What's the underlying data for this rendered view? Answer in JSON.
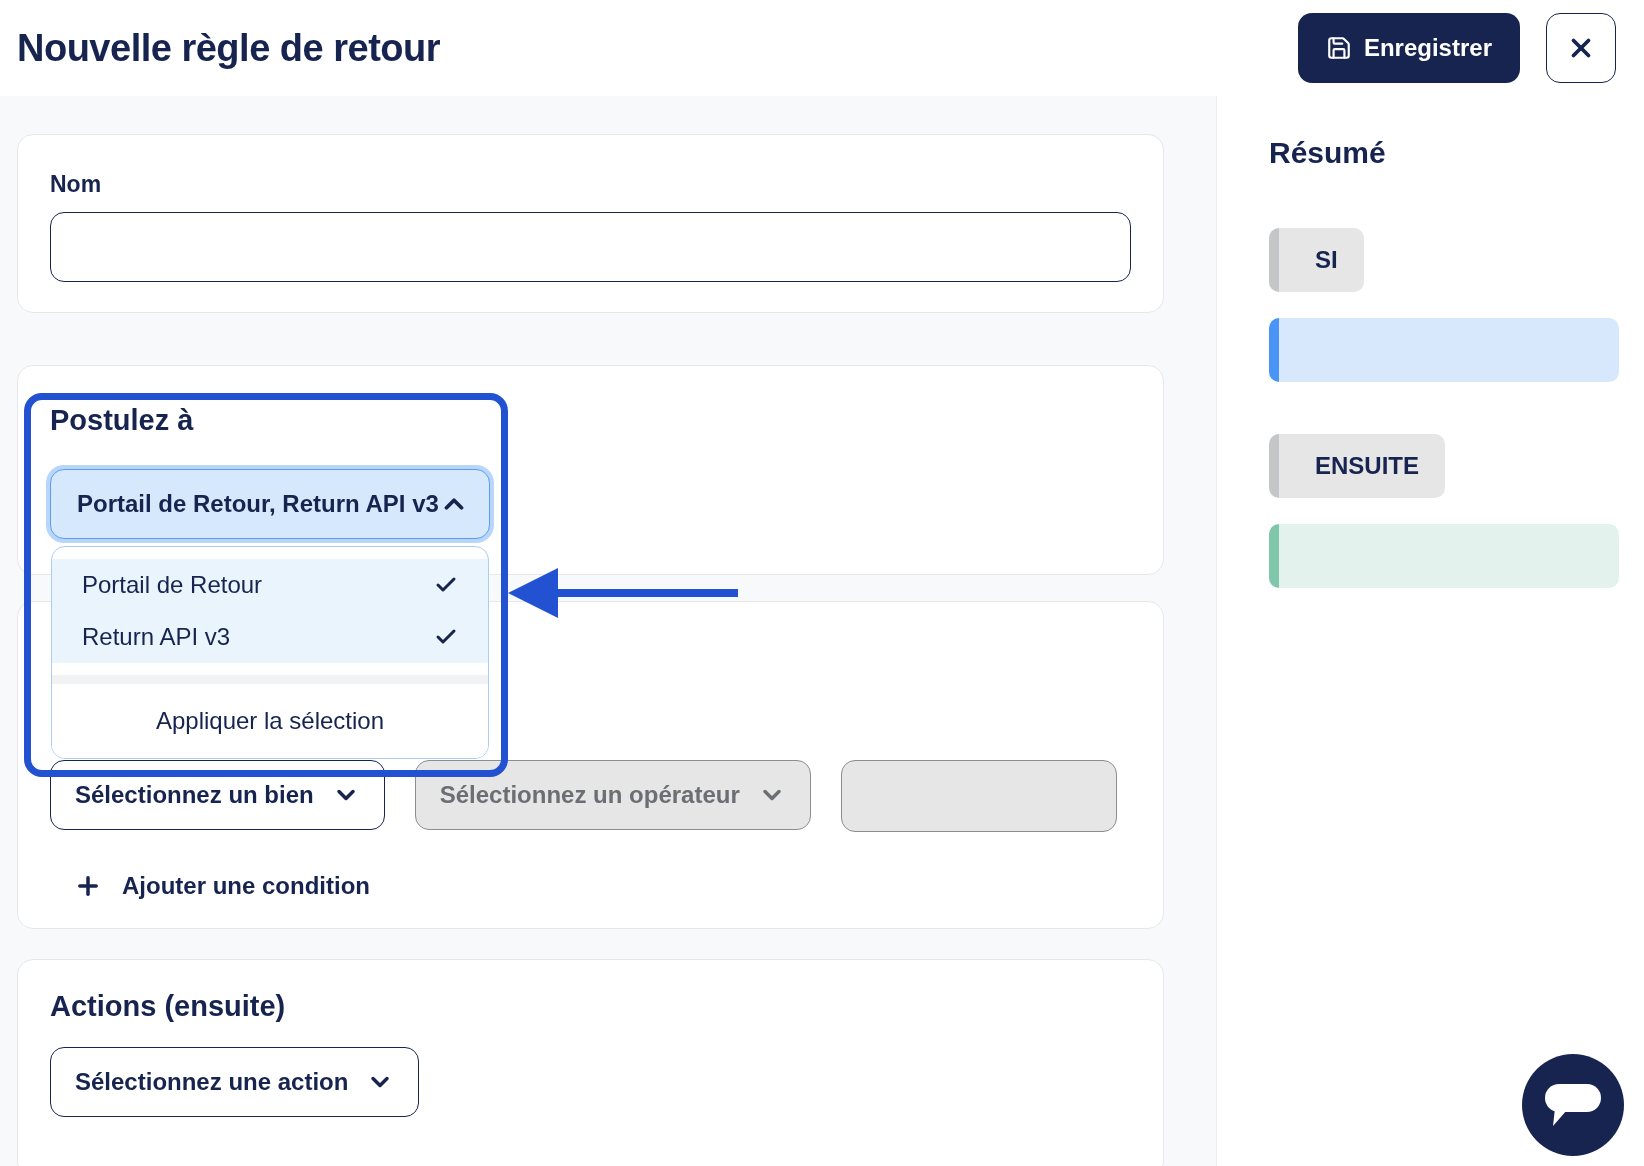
{
  "header": {
    "title": "Nouvelle règle de retour",
    "save_button": "Enregistrer"
  },
  "name_field": {
    "label": "Nom"
  },
  "apply_to": {
    "title": "Postulez à",
    "value": "Portail de Retour, Return API v3",
    "expanded": true,
    "apply_button": "Appliquer la sélection",
    "options": [
      {
        "label": "Portail de Retour",
        "selected": true
      },
      {
        "label": "Return API v3",
        "selected": true
      }
    ]
  },
  "conditions": {
    "property_select": "Sélectionnez un bien",
    "operator_select": {
      "placeholder": "Sélectionnez un opérateur",
      "disabled": true
    },
    "value_field": {
      "disabled": true
    },
    "add_button": "Ajouter une condition"
  },
  "actions": {
    "title": "Actions (ensuite)",
    "action_select": "Sélectionnez une action"
  },
  "summary": {
    "title": "Résumé",
    "blocks": [
      {
        "label": "SI",
        "color": "#4a94f8"
      },
      {
        "label": "ENSUITE",
        "color": "#7fc6ab"
      }
    ]
  }
}
